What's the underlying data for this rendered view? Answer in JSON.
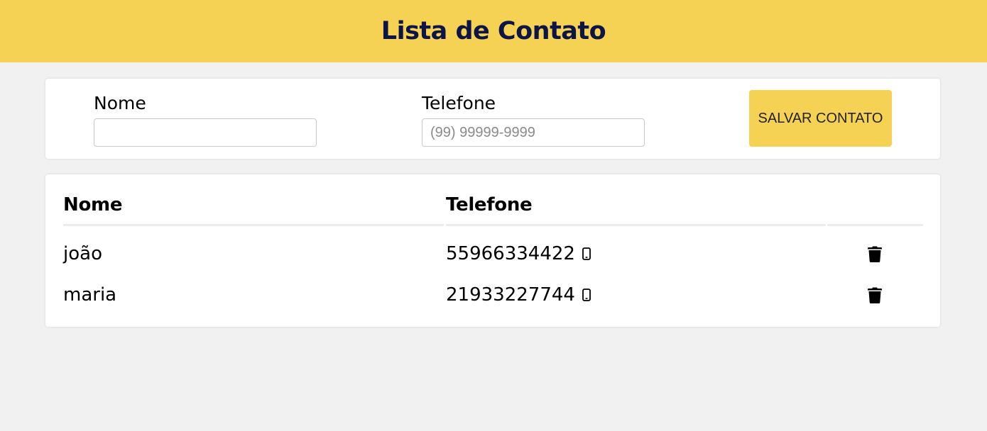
{
  "header": {
    "title": "Lista de Contato"
  },
  "form": {
    "nome_label": "Nome",
    "nome_value": "",
    "telefone_label": "Telefone",
    "telefone_placeholder": "(99) 99999-9999",
    "save_label": "SALVAR CONTATO"
  },
  "table": {
    "headers": [
      "Nome",
      "Telefone",
      ""
    ],
    "rows": [
      {
        "nome": "joão",
        "telefone": "55966334422",
        "phone_icon": "mobile-phone-icon",
        "action_icon": "trash-icon"
      },
      {
        "nome": "maria",
        "telefone": "21933227744",
        "phone_icon": "mobile-phone-icon",
        "action_icon": "trash-icon"
      }
    ]
  },
  "colors": {
    "accent": "#f5d253",
    "title": "#0d1446",
    "background": "#f1f1f1"
  }
}
